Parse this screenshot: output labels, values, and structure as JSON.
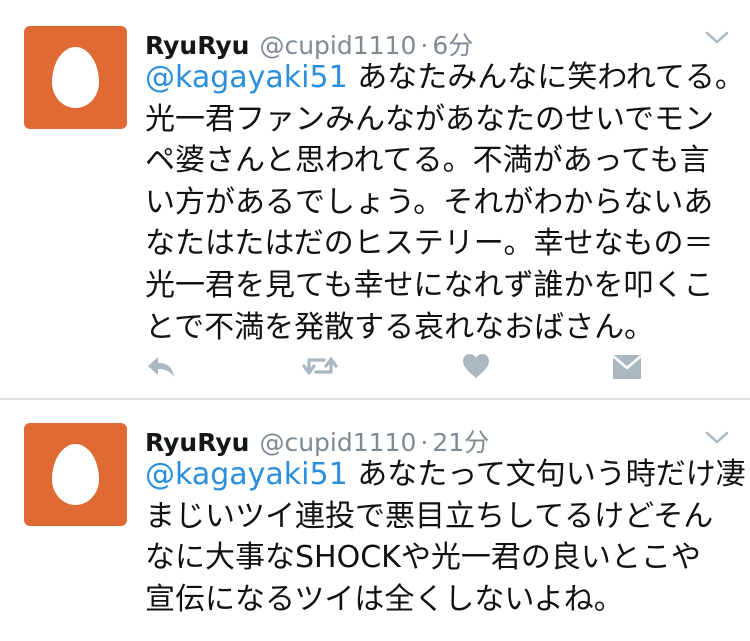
{
  "tweets": [
    {
      "name": "RyuRyu",
      "handle": "@cupid1110",
      "sep": "·",
      "time": "6分",
      "mention": "@kagayaki51",
      "line1_rest": " あなたみんなに笑われてる。",
      "lines": [
        "光一君ファンみんながあなたのせいでモン",
        "ペ婆さんと思われてる。不満があっても言",
        "い方があるでしょう。それがわからないあ",
        "なたはたはだのヒステリー。幸せなもの＝",
        "光一君を見ても幸せになれず誰かを叩くこ",
        "とで不満を発散する哀れなおばさん。"
      ],
      "actions": [
        "reply-icon",
        "retweet-icon",
        "like-icon",
        "dm-icon"
      ]
    },
    {
      "name": "RyuRyu",
      "handle": "@cupid1110",
      "sep": "·",
      "time": "21分",
      "mention": "@kagayaki51",
      "line1_rest": " あなたって文句いう時だけ凄",
      "lines": [
        "まじいツイ連投で悪目立ちしてるけどそん",
        "なに大事なSHOCKや光一君の良いとこや",
        "宣伝になるツイは全くしないよね。"
      ]
    }
  ],
  "colors": {
    "avatar_bg": "#e06a34",
    "mention": "#2b8fdb",
    "meta": "#7f8a95",
    "icon": "#aab8c2"
  }
}
